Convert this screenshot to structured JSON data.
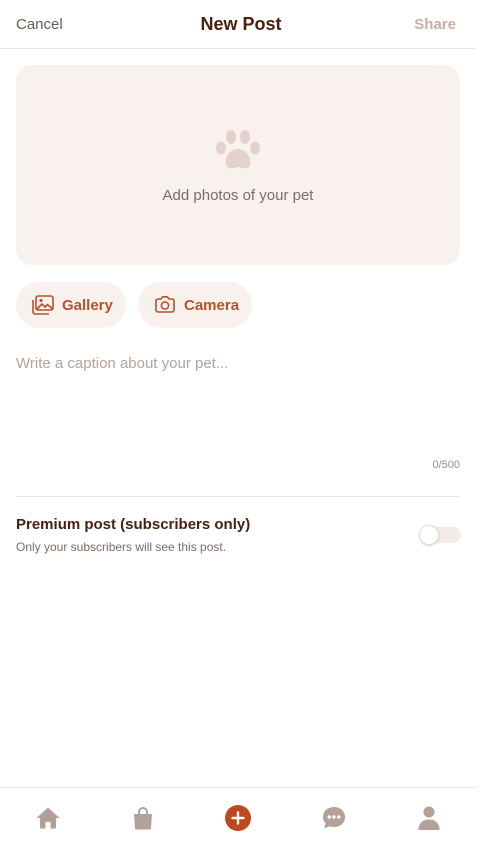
{
  "header": {
    "cancel_label": "Cancel",
    "title": "New Post",
    "share_label": "Share"
  },
  "photo_area": {
    "icon": "paw-icon",
    "text": "Add photos of your pet"
  },
  "source_buttons": [
    {
      "label": "Gallery",
      "icon": "gallery-icon"
    },
    {
      "label": "Camera",
      "icon": "camera-icon"
    }
  ],
  "caption": {
    "placeholder": "Write a caption about your pet...",
    "value": "",
    "counter": "0/500"
  },
  "premium": {
    "title": "Premium post (subscribers only)",
    "subtitle": "Only your subscribers will see this post.",
    "enabled": false
  },
  "tabbar": {
    "items": [
      {
        "icon": "home-icon",
        "active": false
      },
      {
        "icon": "shopping-bag-icon",
        "active": false
      },
      {
        "icon": "plus-circle-icon",
        "active": true
      },
      {
        "icon": "chat-bubble-icon",
        "active": false
      },
      {
        "icon": "person-icon",
        "active": false
      }
    ]
  },
  "colors": {
    "accent": "#b5532a",
    "accent_strong": "#c0481f",
    "surface": "#f9f1ee",
    "title_text": "#4a200e",
    "muted_icon": "#b3a099"
  }
}
